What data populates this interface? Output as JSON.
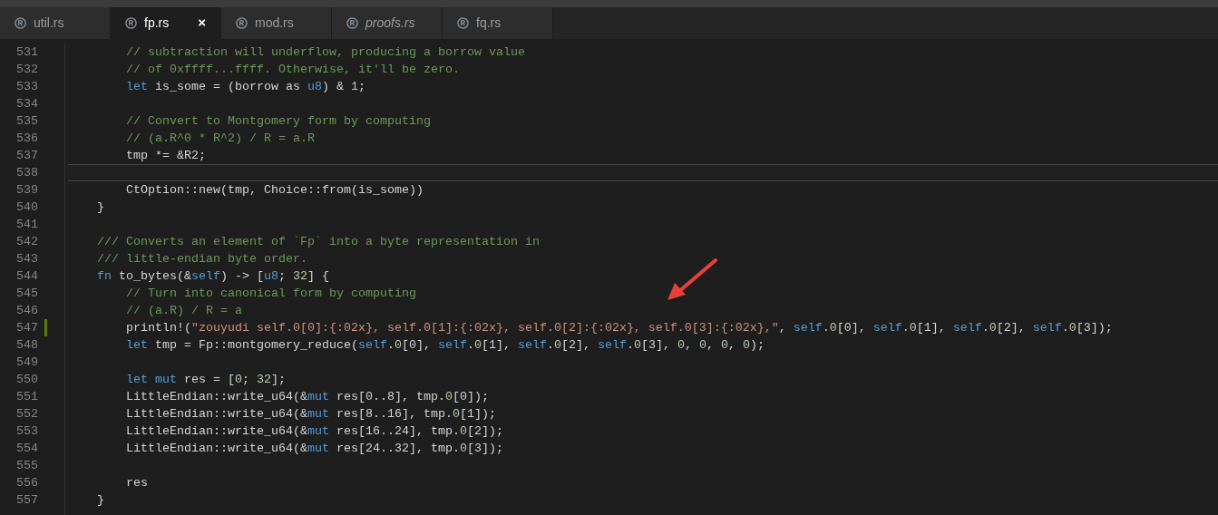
{
  "tabs": [
    {
      "label": "util.rs",
      "selected": false,
      "preview": false
    },
    {
      "label": "fp.rs",
      "selected": true,
      "preview": false,
      "close": "×"
    },
    {
      "label": "mod.rs",
      "selected": false,
      "preview": false
    },
    {
      "label": "proofs.rs",
      "selected": false,
      "preview": true
    },
    {
      "label": "fq.rs",
      "selected": false,
      "preview": false
    }
  ],
  "editor": {
    "lines": [
      {
        "number": "531",
        "current": false,
        "modified": false,
        "tokens": [
          {
            "kind": "comment",
            "text": "        // subtraction will underflow, producing a borrow value"
          }
        ]
      },
      {
        "number": "532",
        "current": false,
        "modified": false,
        "tokens": [
          {
            "kind": "comment",
            "text": "        // of 0xffff...ffff. Otherwise, it'll be zero."
          }
        ]
      },
      {
        "number": "533",
        "current": false,
        "modified": false,
        "tokens": [
          {
            "kind": "keyword",
            "text": "        let"
          },
          {
            "kind": "plain",
            "text": " is_some = (borrow as "
          },
          {
            "kind": "keyword",
            "text": "u8"
          },
          {
            "kind": "plain",
            "text": ") & "
          },
          {
            "kind": "number",
            "text": "1"
          },
          {
            "kind": "plain",
            "text": ";"
          }
        ]
      },
      {
        "number": "534",
        "current": false,
        "modified": false
      },
      {
        "number": "535",
        "current": false,
        "modified": false,
        "tokens": [
          {
            "kind": "comment",
            "text": "        // Convert to Montgomery form by computing"
          }
        ]
      },
      {
        "number": "536",
        "current": false,
        "modified": false,
        "tokens": [
          {
            "kind": "comment",
            "text": "        // (a.R^0 * R^2) / R = a.R"
          }
        ]
      },
      {
        "number": "537",
        "current": false,
        "modified": false,
        "tokens": [
          {
            "kind": "plain",
            "text": "        tmp *= &R2;"
          }
        ]
      },
      {
        "number": "538",
        "current": true,
        "modified": false
      },
      {
        "number": "539",
        "current": false,
        "modified": false,
        "tokens": [
          {
            "kind": "plain",
            "text": "        CtOption::new(tmp, Choice::from(is_some))"
          }
        ]
      },
      {
        "number": "540",
        "current": false,
        "modified": false,
        "tokens": [
          {
            "kind": "plain",
            "text": "    }"
          }
        ]
      },
      {
        "number": "541",
        "current": false,
        "modified": false
      },
      {
        "number": "542",
        "current": false,
        "modified": false,
        "tokens": [
          {
            "kind": "comment",
            "text": "    /// Converts an element of `Fp` into a byte representation in"
          }
        ]
      },
      {
        "number": "543",
        "current": false,
        "modified": false,
        "tokens": [
          {
            "kind": "comment",
            "text": "    /// little-endian byte order."
          }
        ]
      },
      {
        "number": "544",
        "current": false,
        "modified": false,
        "tokens": [
          {
            "kind": "keyword",
            "text": "    fn"
          },
          {
            "kind": "plain",
            "text": " to_bytes(&"
          },
          {
            "kind": "keyword",
            "text": "self"
          },
          {
            "kind": "plain",
            "text": ") -> ["
          },
          {
            "kind": "keyword",
            "text": "u8"
          },
          {
            "kind": "plain",
            "text": "; "
          },
          {
            "kind": "number",
            "text": "32"
          },
          {
            "kind": "plain",
            "text": "] {"
          }
        ]
      },
      {
        "number": "545",
        "current": false,
        "modified": false,
        "tokens": [
          {
            "kind": "comment",
            "text": "        // Turn into canonical form by computing"
          }
        ]
      },
      {
        "number": "546",
        "current": false,
        "modified": false,
        "tokens": [
          {
            "kind": "comment",
            "text": "        // (a.R) / R = a"
          }
        ]
      },
      {
        "number": "547",
        "current": false,
        "modified": true,
        "tokens": [
          {
            "kind": "plain",
            "text": "        println!("
          },
          {
            "kind": "string",
            "text": "\"zouyudi self.0[0]:{:02x}, self.0[1]:{:02x}, self.0[2]:{:02x}, self.0[3]:{:02x},\""
          },
          {
            "kind": "plain",
            "text": ", "
          },
          {
            "kind": "keyword",
            "text": "self"
          },
          {
            "kind": "plain",
            "text": "."
          },
          {
            "kind": "number",
            "text": "0"
          },
          {
            "kind": "plain",
            "text": "[0], "
          },
          {
            "kind": "keyword",
            "text": "self"
          },
          {
            "kind": "plain",
            "text": "."
          },
          {
            "kind": "number",
            "text": "0"
          },
          {
            "kind": "plain",
            "text": "[1], "
          },
          {
            "kind": "keyword",
            "text": "self"
          },
          {
            "kind": "plain",
            "text": "."
          },
          {
            "kind": "number",
            "text": "0"
          },
          {
            "kind": "plain",
            "text": "[2], "
          },
          {
            "kind": "keyword",
            "text": "self"
          },
          {
            "kind": "plain",
            "text": "."
          },
          {
            "kind": "number",
            "text": "0"
          },
          {
            "kind": "plain",
            "text": "[3]);"
          }
        ]
      },
      {
        "number": "548",
        "current": false,
        "modified": false,
        "tokens": [
          {
            "kind": "keyword",
            "text": "        let"
          },
          {
            "kind": "plain",
            "text": " tmp = Fp::montgomery_reduce("
          },
          {
            "kind": "keyword",
            "text": "self"
          },
          {
            "kind": "plain",
            "text": "."
          },
          {
            "kind": "number",
            "text": "0"
          },
          {
            "kind": "plain",
            "text": "[0], "
          },
          {
            "kind": "keyword",
            "text": "self"
          },
          {
            "kind": "plain",
            "text": "."
          },
          {
            "kind": "number",
            "text": "0"
          },
          {
            "kind": "plain",
            "text": "[1], "
          },
          {
            "kind": "keyword",
            "text": "self"
          },
          {
            "kind": "plain",
            "text": "."
          },
          {
            "kind": "number",
            "text": "0"
          },
          {
            "kind": "plain",
            "text": "[2], "
          },
          {
            "kind": "keyword",
            "text": "self"
          },
          {
            "kind": "plain",
            "text": "."
          },
          {
            "kind": "number",
            "text": "0"
          },
          {
            "kind": "plain",
            "text": "[3], "
          },
          {
            "kind": "number",
            "text": "0"
          },
          {
            "kind": "plain",
            "text": ", "
          },
          {
            "kind": "number",
            "text": "0"
          },
          {
            "kind": "plain",
            "text": ", "
          },
          {
            "kind": "number",
            "text": "0"
          },
          {
            "kind": "plain",
            "text": ", "
          },
          {
            "kind": "number",
            "text": "0"
          },
          {
            "kind": "plain",
            "text": ");"
          }
        ]
      },
      {
        "number": "549",
        "current": false,
        "modified": false
      },
      {
        "number": "550",
        "current": false,
        "modified": false,
        "tokens": [
          {
            "kind": "keyword",
            "text": "        let mut"
          },
          {
            "kind": "plain",
            "text": " res = ["
          },
          {
            "kind": "number",
            "text": "0"
          },
          {
            "kind": "plain",
            "text": "; "
          },
          {
            "kind": "number",
            "text": "32"
          },
          {
            "kind": "plain",
            "text": "];"
          }
        ]
      },
      {
        "number": "551",
        "current": false,
        "modified": false,
        "tokens": [
          {
            "kind": "plain",
            "text": "        LittleEndian::write_u64(&"
          },
          {
            "kind": "keyword",
            "text": "mut"
          },
          {
            "kind": "plain",
            "text": " res[0..8], tmp."
          },
          {
            "kind": "number",
            "text": "0"
          },
          {
            "kind": "plain",
            "text": "[0]);"
          }
        ]
      },
      {
        "number": "552",
        "current": false,
        "modified": false,
        "tokens": [
          {
            "kind": "plain",
            "text": "        LittleEndian::write_u64(&"
          },
          {
            "kind": "keyword",
            "text": "mut"
          },
          {
            "kind": "plain",
            "text": " res[8..16], tmp."
          },
          {
            "kind": "number",
            "text": "0"
          },
          {
            "kind": "plain",
            "text": "[1]);"
          }
        ]
      },
      {
        "number": "553",
        "current": false,
        "modified": false,
        "tokens": [
          {
            "kind": "plain",
            "text": "        LittleEndian::write_u64(&"
          },
          {
            "kind": "keyword",
            "text": "mut"
          },
          {
            "kind": "plain",
            "text": " res[16..24], tmp."
          },
          {
            "kind": "number",
            "text": "0"
          },
          {
            "kind": "plain",
            "text": "[2]);"
          }
        ]
      },
      {
        "number": "554",
        "current": false,
        "modified": false,
        "tokens": [
          {
            "kind": "plain",
            "text": "        LittleEndian::write_u64(&"
          },
          {
            "kind": "keyword",
            "text": "mut"
          },
          {
            "kind": "plain",
            "text": " res[24..32], tmp."
          },
          {
            "kind": "number",
            "text": "0"
          },
          {
            "kind": "plain",
            "text": "[3]);"
          }
        ]
      },
      {
        "number": "555",
        "current": false,
        "modified": false
      },
      {
        "number": "556",
        "current": false,
        "modified": false,
        "tokens": [
          {
            "kind": "plain",
            "text": "        res"
          }
        ]
      },
      {
        "number": "557",
        "current": false,
        "modified": false,
        "tokens": [
          {
            "kind": "plain",
            "text": "    }"
          }
        ]
      }
    ]
  }
}
